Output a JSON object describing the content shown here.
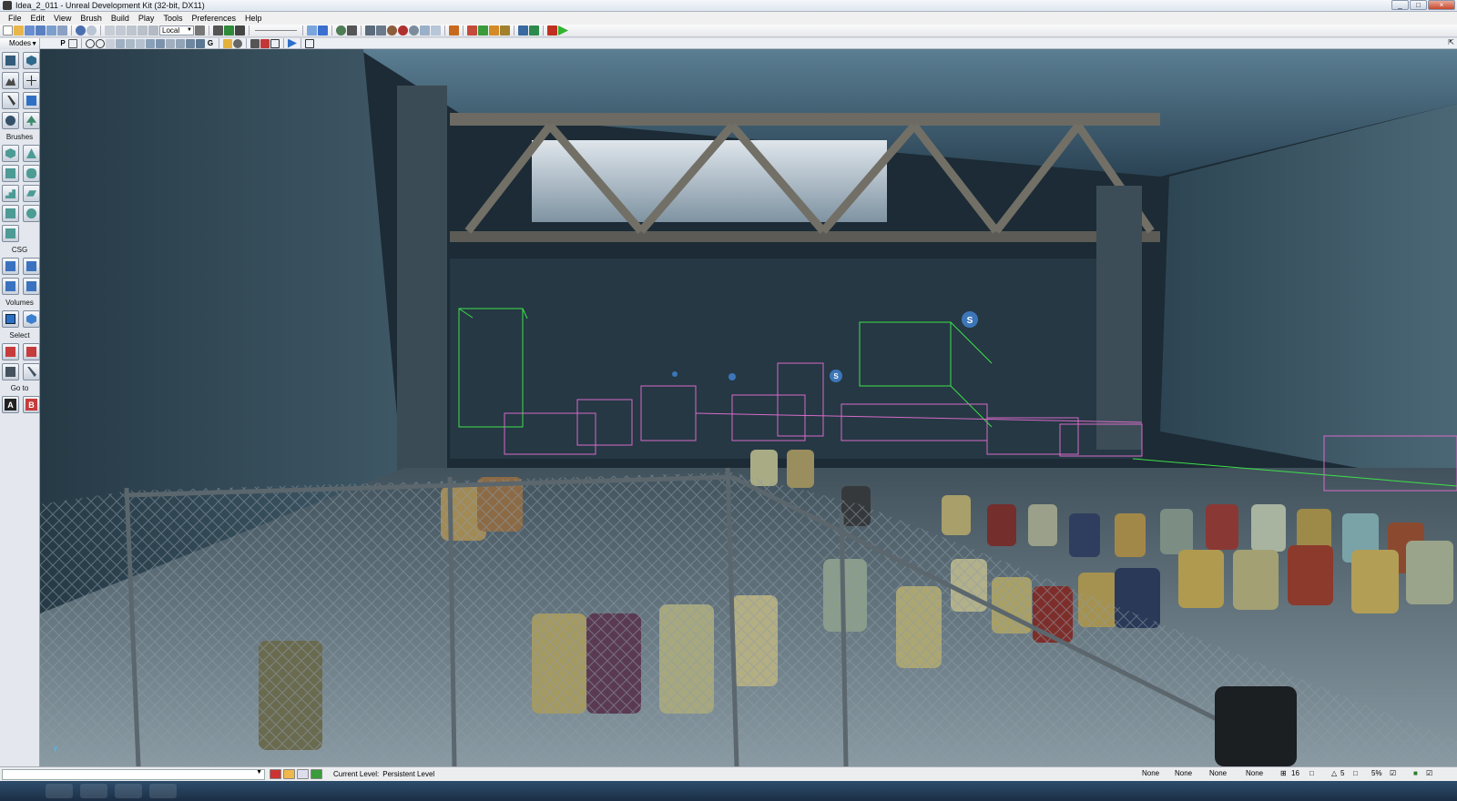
{
  "window": {
    "title": "Idea_2_011 - Unreal Development Kit (32-bit, DX11)",
    "min": "_",
    "max": "□",
    "close": "×"
  },
  "menu": [
    "File",
    "Edit",
    "View",
    "Brush",
    "Build",
    "Play",
    "Tools",
    "Preferences",
    "Help"
  ],
  "toolbar": {
    "coord_system": "Local"
  },
  "modes": {
    "label": "Modes",
    "sections": {
      "brushes": "Brushes",
      "csg": "CSG",
      "volumes": "Volumes",
      "select": "Select",
      "goto": "Go to"
    },
    "goto_buttons": [
      "A",
      "B"
    ]
  },
  "viewport": {
    "axis_label": "Y",
    "markers": [
      "S",
      "S"
    ]
  },
  "statusbar": {
    "current_level_label": "Current Level:",
    "current_level_value": "Persistent Level",
    "fields": [
      "None",
      "None",
      "None",
      "None"
    ],
    "grid_size": "16",
    "angle": "5",
    "scale": "5%"
  },
  "colors": {
    "titlebar": "#dfe6ef",
    "panel": "#e4e8ee",
    "wire_green": "#3ee04a",
    "wire_pink": "#d86ac8"
  }
}
